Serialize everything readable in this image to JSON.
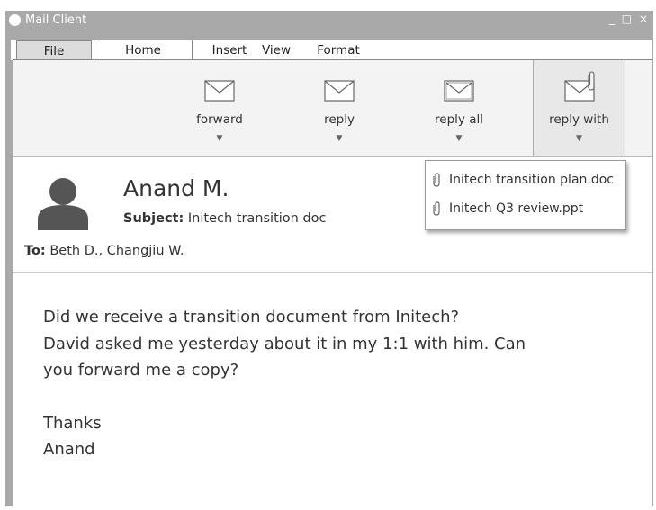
{
  "window": {
    "title": "Mail Client",
    "controls": [
      "_",
      "□",
      "×"
    ]
  },
  "menu": {
    "items": [
      "File",
      "Home",
      "Insert",
      "View",
      "Format"
    ]
  },
  "ribbon": {
    "buttons": [
      {
        "label": "forward",
        "icon": "envelope-icon"
      },
      {
        "label": "reply",
        "icon": "envelope-icon"
      },
      {
        "label": "reply all",
        "icon": "envelope-icon"
      },
      {
        "label": "reply with",
        "icon": "envelope-paperclip-icon"
      }
    ],
    "arrow": "▼"
  },
  "attachments_menu": {
    "items": [
      "Initech transition plan.doc",
      "Initech Q3 review.ppt"
    ],
    "icon": "paperclip-icon"
  },
  "message": {
    "sender": "Anand M.",
    "subject_label": "Subject:",
    "subject": "Initech transition doc",
    "to_label": "To:",
    "to": "Beth D., Changjiu W.",
    "body_lines": [
      "Did we receive a transition document from Initech?",
      "David asked me yesterday about it in my 1:1 with him. Can",
      "you forward me a copy?",
      "",
      "Thanks",
      "Anand"
    ]
  },
  "colors": {
    "titlebar": "#a9a9a9",
    "ribbon": "#f3f3f3",
    "avatar": "#555555"
  }
}
